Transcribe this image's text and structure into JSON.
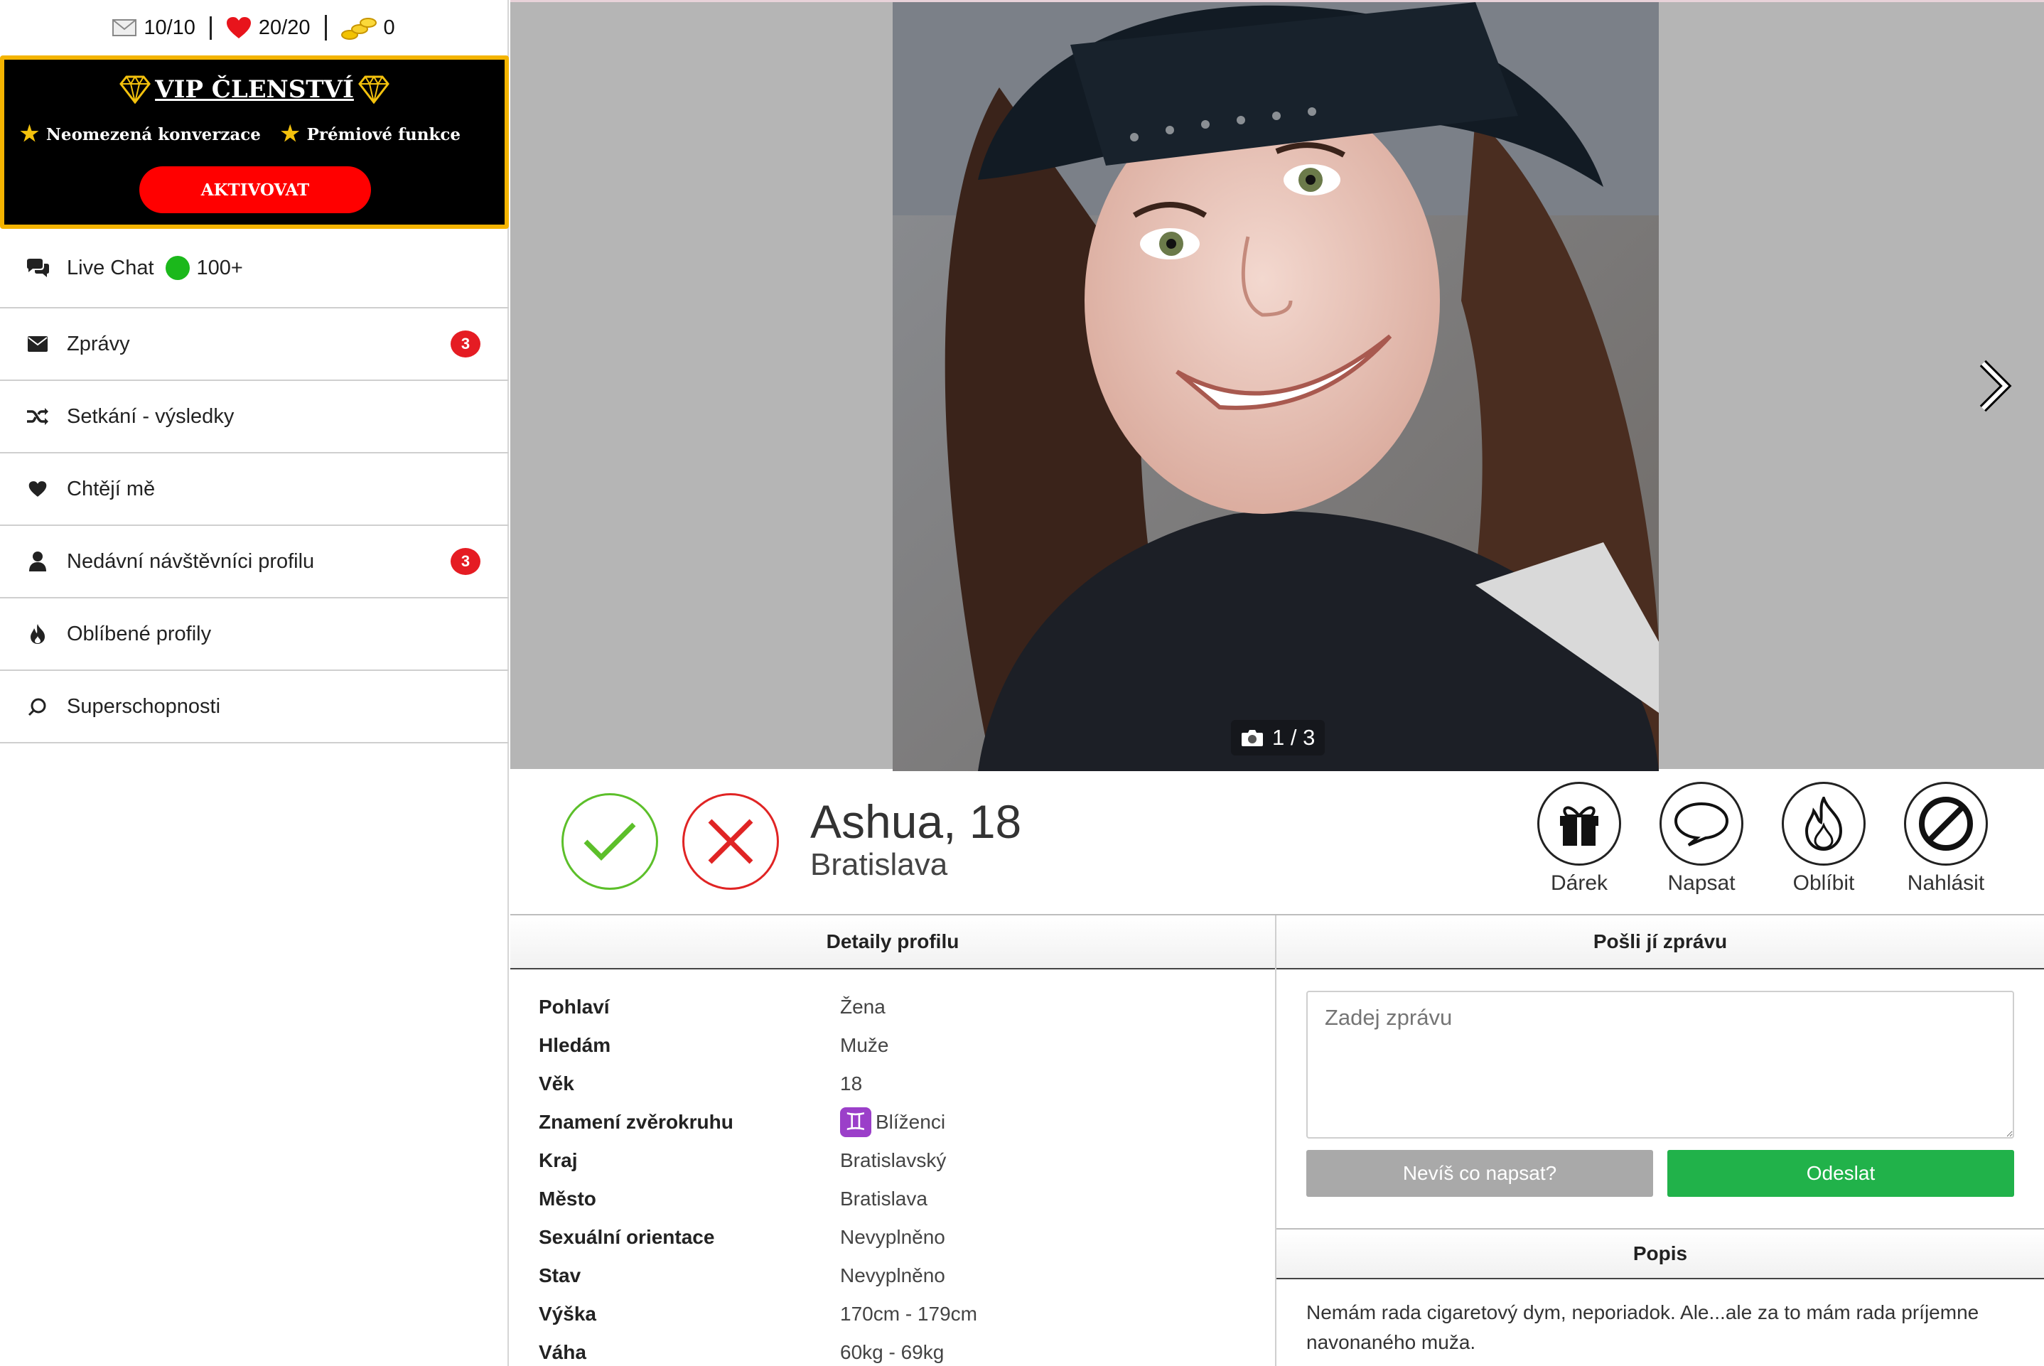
{
  "counters": {
    "messages": "10/10",
    "likes": "20/20",
    "coins": "0"
  },
  "vip": {
    "title": "VIP ČLENSTVÍ",
    "feature1": "Neomezená konverzace",
    "feature2": "Prémiové funkce",
    "button": "AKTIVOVAT"
  },
  "menu": {
    "live_chat": {
      "label": "Live Chat",
      "count": "100+"
    },
    "messages": {
      "label": "Zprávy",
      "badge": "3"
    },
    "matches": {
      "label": "Setkání - výsledky"
    },
    "likes_me": {
      "label": "Chtějí mě"
    },
    "visitors": {
      "label": "Nedávní návštěvníci profilu",
      "badge": "3"
    },
    "favorites": {
      "label": "Oblíbené profily"
    },
    "superpowers": {
      "label": "Superschopnosti"
    }
  },
  "photo": {
    "counter": "1 / 3"
  },
  "profile": {
    "name": "Ashua, 18",
    "city": "Bratislava",
    "actions": {
      "gift": "Dárek",
      "write": "Napsat",
      "favorite": "Oblíbit",
      "report": "Nahlásit"
    }
  },
  "details": {
    "title": "Detaily profilu",
    "rows": [
      {
        "key": "Pohlaví",
        "value": "Žena"
      },
      {
        "key": "Hledám",
        "value": "Muže"
      },
      {
        "key": "Věk",
        "value": "18"
      },
      {
        "key": "Znamení zvěrokruhu",
        "value": "Blíženci"
      },
      {
        "key": "Kraj",
        "value": "Bratislavský"
      },
      {
        "key": "Město",
        "value": "Bratislava"
      },
      {
        "key": "Sexuální orientace",
        "value": "Nevyplněno"
      },
      {
        "key": "Stav",
        "value": "Nevyplněno"
      },
      {
        "key": "Výška",
        "value": "170cm - 179cm"
      },
      {
        "key": "Váha",
        "value": "60kg - 69kg"
      }
    ]
  },
  "message": {
    "title": "Pošli jí zprávu",
    "placeholder": "Zadej zprávu",
    "suggest_button": "Nevíš co napsat?",
    "send_button": "Odeslat"
  },
  "description": {
    "title": "Popis",
    "text": "Nemám rada cigaretový dym, neporiadok. Ale...ale za to mám rada príjemne navonaného muža."
  },
  "colors": {
    "accent_red": "#ff0000",
    "gold": "#f4b400",
    "online_green": "#1bb81b",
    "send_green": "#21b24a"
  }
}
